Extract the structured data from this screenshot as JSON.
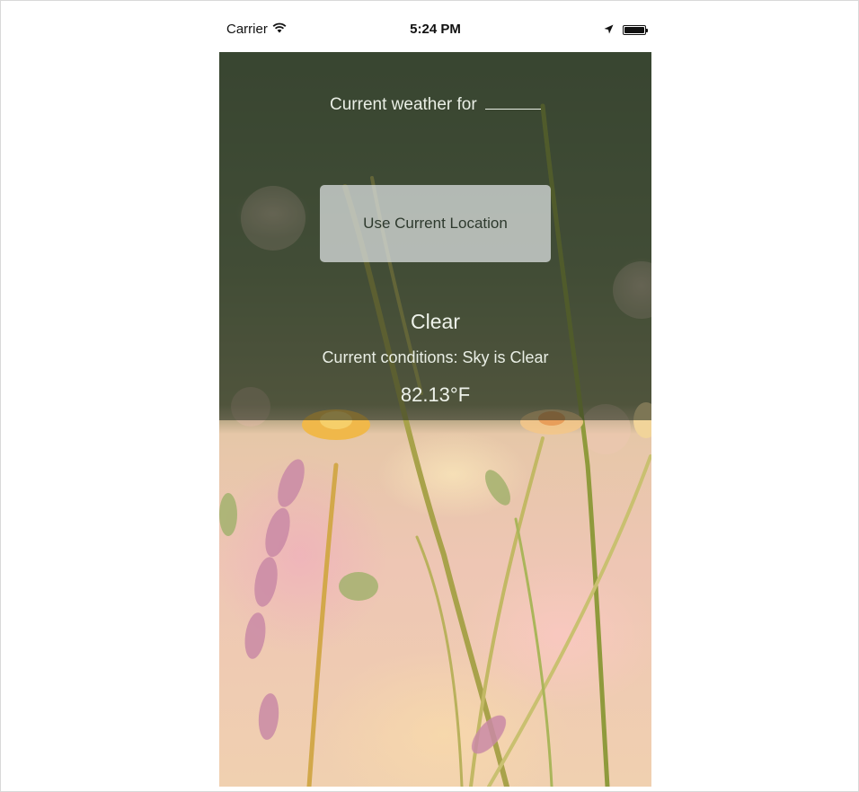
{
  "status_bar": {
    "carrier": "Carrier",
    "time": "5:24 PM",
    "battery_level_percent": 100,
    "icons": [
      "wifi-icon",
      "location-arrow-icon",
      "battery-icon"
    ]
  },
  "weather": {
    "title": "Current weather for",
    "location_placeholder": "",
    "button_label": "Use Current Location",
    "main_condition": "Clear",
    "conditions_text": "Current conditions: Sky is Clear",
    "temperature": "82.13°F"
  },
  "colors": {
    "overlay": "#1e281e",
    "button_bg": "#e1e4e6",
    "text_light": "#e9eee5",
    "button_text": "#2e3a2e"
  }
}
